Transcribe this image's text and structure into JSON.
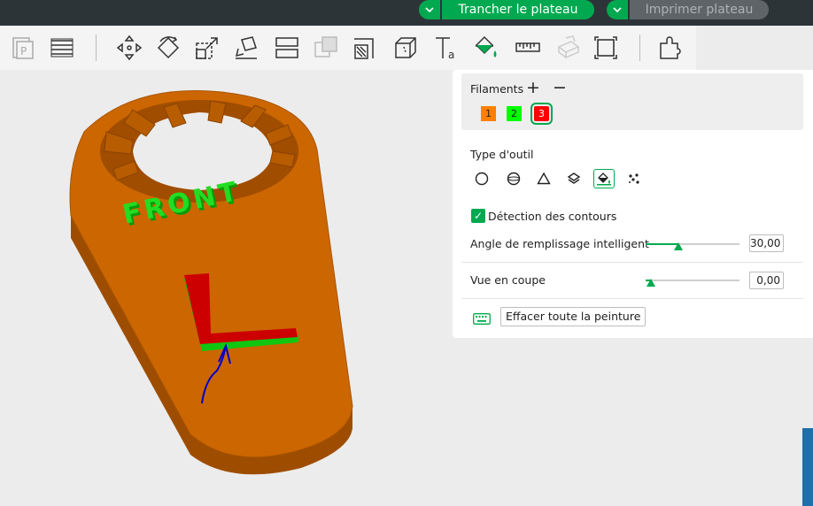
{
  "header": {
    "slice_label": "Trancher le plateau",
    "print_label": "Imprimer plateau",
    "chevron": "chevron-down-icon"
  },
  "toolbar": {
    "icons": [
      "plate-icon",
      "layers-icon",
      "move-icon",
      "rotate-icon",
      "scale-icon",
      "lay-on-face-icon",
      "split-icon",
      "boolean-icon",
      "cut-icon",
      "measure-box-icon",
      "text-icon",
      "paint-icon",
      "ruler-icon",
      "assembly-icon",
      "fit-icon",
      "support-icon"
    ]
  },
  "scene": {
    "model_text": "FRONT",
    "colors": {
      "body": "#cc6600",
      "green": "#11c611",
      "red": "#cc0000",
      "arrow": "#0000cc"
    }
  },
  "panel": {
    "filaments_title": "Filaments",
    "add_symbol": "+",
    "remove_symbol": "−",
    "filaments": [
      {
        "label": "1",
        "color": "#ff8000"
      },
      {
        "label": "2",
        "color": "#00ff00"
      },
      {
        "label": "3",
        "color": "#ff0000",
        "selected": true
      }
    ],
    "tool_type_label": "Type d'outil",
    "tools": [
      "circle-icon",
      "sphere-icon",
      "triangle-icon",
      "layers-fill-icon",
      "bucket-fill-icon",
      "gap-fill-icon"
    ],
    "edge_detection_label": "Détection des contours",
    "edge_detection_checked": true,
    "smart_fill_label": "Angle de remplissage intelligent",
    "smart_fill_value": "30,00",
    "smart_fill_fraction": 0.35,
    "section_view_label": "Vue en coupe",
    "section_view_value": "0,00",
    "section_view_fraction": 0.06,
    "erase_all_label": "Effacer toute la peinture"
  }
}
